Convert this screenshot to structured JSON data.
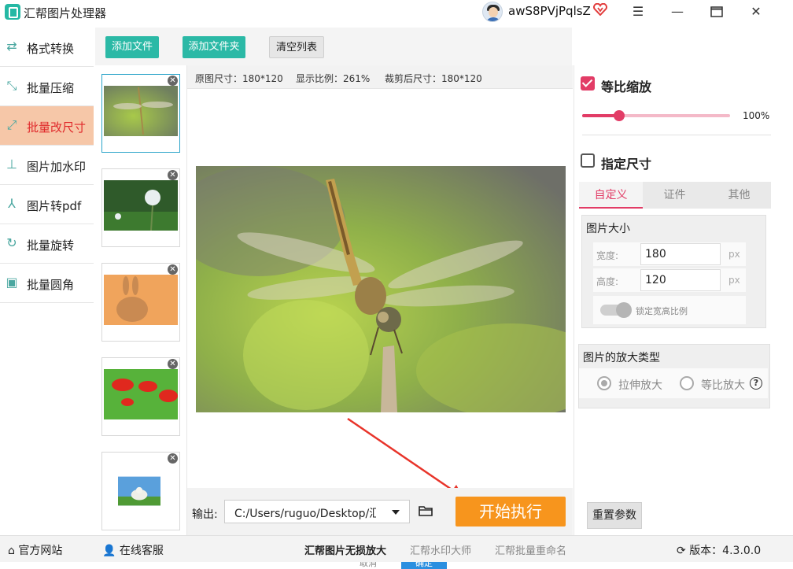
{
  "titlebar": {
    "app_title": "汇帮图片处理器",
    "username": "awS8PVjPqlsZ",
    "icons": [
      "app-logo-icon",
      "avatar-icon",
      "vip-heart-icon",
      "menu-icon",
      "minimize-icon",
      "maximize-icon",
      "close-icon"
    ]
  },
  "sidebar": {
    "items": [
      {
        "label": "格式转换",
        "icon": "format-convert-icon"
      },
      {
        "label": "批量压缩",
        "icon": "compress-icon"
      },
      {
        "label": "批量改尺寸",
        "icon": "resize-icon",
        "active": true
      },
      {
        "label": "图片加水印",
        "icon": "watermark-icon"
      },
      {
        "label": "图片转pdf",
        "icon": "pdf-icon"
      },
      {
        "label": "批量旋转",
        "icon": "rotate-icon"
      },
      {
        "label": "批量圆角",
        "icon": "rounded-corner-icon"
      }
    ]
  },
  "toolbar": {
    "add_file": "添加文件",
    "add_folder": "添加文件夹",
    "clear_list": "清空列表"
  },
  "thumbnails": [
    {
      "subject": "dragonfly",
      "selected": true
    },
    {
      "subject": "dandelion"
    },
    {
      "subject": "rabbit"
    },
    {
      "subject": "red flowers"
    },
    {
      "subject": "sheep"
    }
  ],
  "preview": {
    "original_size": "原图尺寸：180*120",
    "display_ratio": "显示比例：261%",
    "cropped_size": "裁剪后尺寸：180*120"
  },
  "output": {
    "label": "输出:",
    "path": "C:/Users/ruguo/Desktop/汇帮",
    "run_button": "开始执行"
  },
  "right_panel": {
    "proportional_label": "等比缩放",
    "proportional_checked": true,
    "scale_value": "100%",
    "scale_fraction": 0.25,
    "specify_size_label": "指定尺寸",
    "specify_size_checked": false,
    "tabs": [
      "自定义",
      "证件",
      "其他"
    ],
    "active_tab": 0,
    "image_size_title": "图片大小",
    "width_label": "宽度:",
    "width_value": "180",
    "height_label": "高度:",
    "height_value": "120",
    "unit": "px",
    "lock_ratio_label": "锁定宽高比例",
    "enlarge_type_title": "图片的放大类型",
    "stretch_label": "拉伸放大",
    "proportional_enlarge_label": "等比放大",
    "reset_button": "重置参数"
  },
  "statusbar": {
    "website": "官方网站",
    "support": "在线客服",
    "link_1": "汇帮图片无损放大",
    "link_2": "汇帮水印大师",
    "link_3": "汇帮批量重命名",
    "version": "版本：4.3.0.0"
  },
  "bottom_hidden": {
    "cancel": "取消",
    "confirm": "确定"
  },
  "colors": {
    "accent_teal": "#2bb9a6",
    "accent_pink": "#e23c66",
    "run_orange": "#f7951d",
    "sidebar_active_bg": "#f6c7a8",
    "sidebar_active_text": "#e0282a"
  }
}
